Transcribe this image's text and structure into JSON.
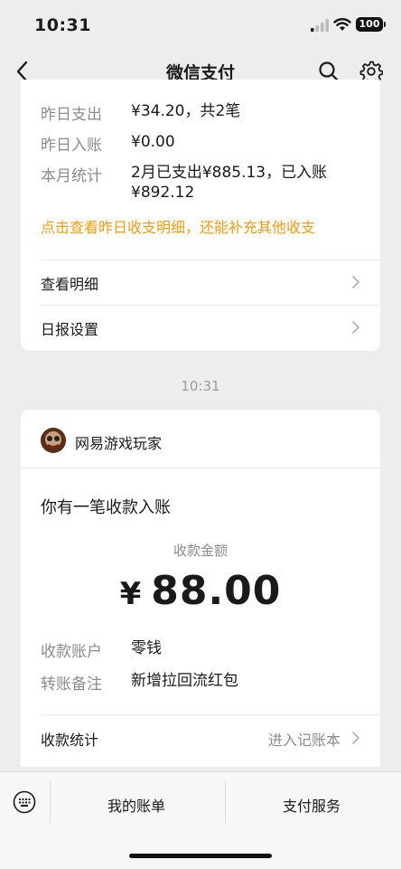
{
  "status": {
    "time": "10:31",
    "battery": "100"
  },
  "nav": {
    "title": "微信支付"
  },
  "summary": {
    "rows": [
      {
        "key": "昨日支出",
        "value": "¥34.20，共2笔"
      },
      {
        "key": "昨日入账",
        "value": "¥0.00"
      },
      {
        "key": "本月统计",
        "value": "2月已支出¥885.13，已入账¥892.12"
      }
    ],
    "link": "点击查看昨日收支明细，还能补充其他收支",
    "menu": [
      {
        "label": "查看明细"
      },
      {
        "label": "日报设置"
      }
    ]
  },
  "timestamp": "10:31",
  "receipt": {
    "brand": "网易游戏玩家",
    "headline": "你有一笔收款入账",
    "amount_label": "收款金额",
    "currency": "¥",
    "amount": "88.00",
    "details": [
      {
        "key": "收款账户",
        "value": "零钱"
      },
      {
        "key": "转账备注",
        "value": "新增拉回流红包"
      }
    ],
    "stats_label": "收款统计",
    "stats_link": "进入记账本"
  },
  "bottom": {
    "tabs": [
      "我的账单",
      "支付服务"
    ]
  },
  "colors": {
    "accent_orange": "#f39c12",
    "background": "#ededed"
  }
}
